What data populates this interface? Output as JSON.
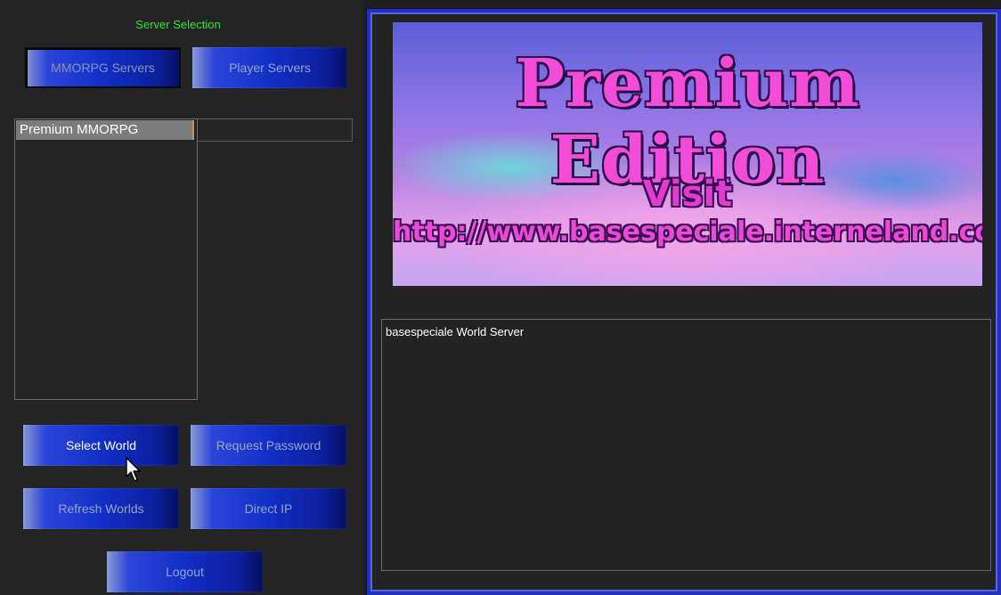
{
  "left": {
    "title": "Server Selection",
    "tabs": {
      "mmorpg": "MMORPG Servers",
      "player": "Player Servers"
    },
    "server_list": {
      "items": [
        "Premium MMORPG"
      ]
    },
    "buttons": {
      "select_world": "Select World",
      "request_password": "Request Password",
      "refresh_worlds": "Refresh Worlds",
      "direct_ip": "Direct IP",
      "logout": "Logout"
    }
  },
  "right": {
    "banner": {
      "title": "Premium Edition",
      "visit": "Visit",
      "url": "http://www.basespeciale.interneland.com"
    },
    "info": {
      "text": "basespeciale World Server"
    }
  },
  "colors": {
    "title_green": "#2ee82e",
    "frame_blue": "#2330b8",
    "button_blue": "#1230c8",
    "banner_pink": "#f24cd8"
  },
  "icons": {
    "cursor": "mouse-pointer-icon"
  }
}
